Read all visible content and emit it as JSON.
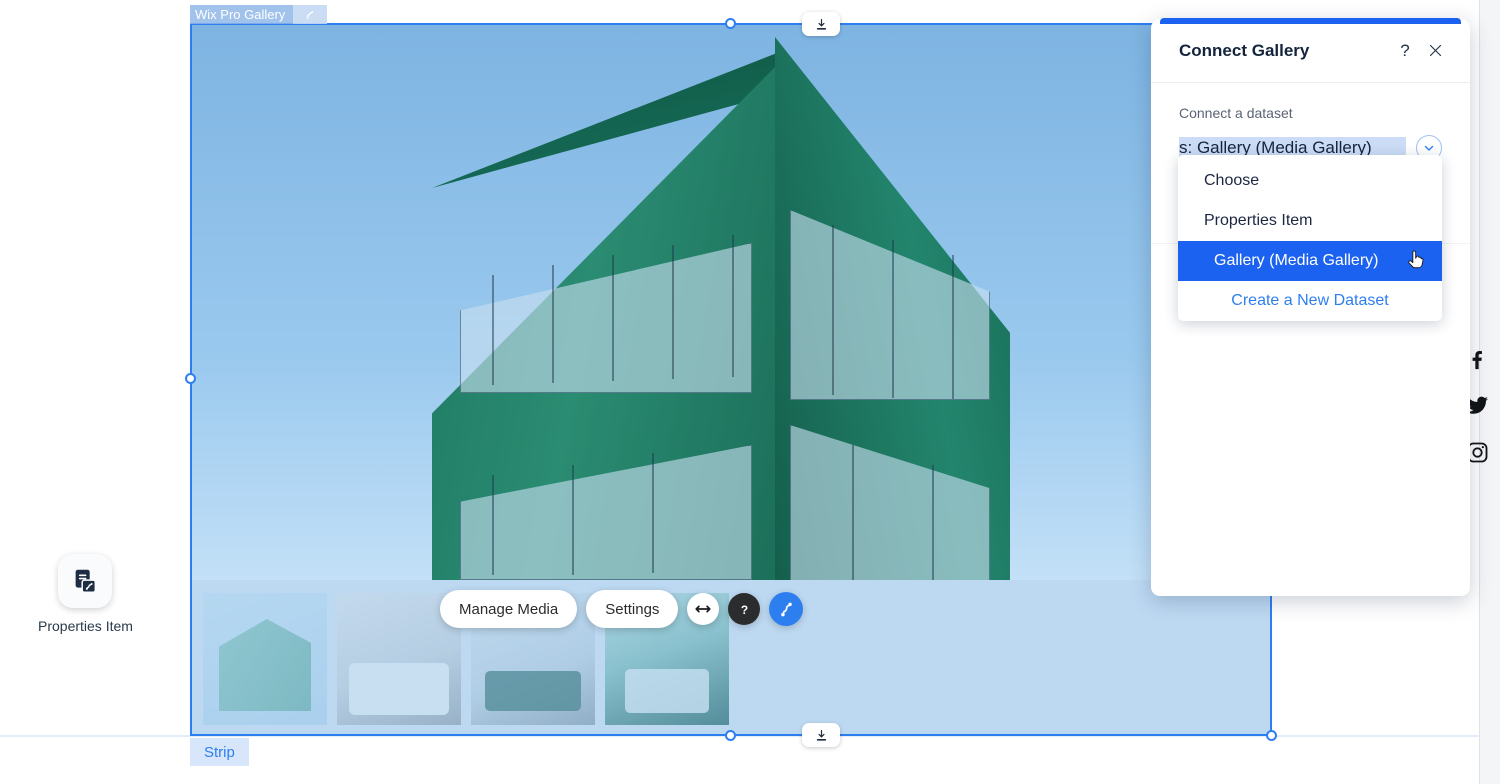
{
  "editor": {
    "widget_tag_label": "Wix Pro Gallery",
    "widget_tag_icon": "connect-icon",
    "strip_tag_label": "Strip",
    "collapse_top_icon": "download-icon",
    "collapse_bottom_icon": "download-icon",
    "accent_blue": "#2d7ff0",
    "selection_fill": "#bdd9f2"
  },
  "gallery_toolbar": {
    "manage_media_label": "Manage Media",
    "settings_label": "Settings",
    "stretch_icon": "arrows-horizontal-icon",
    "help_icon": "question-mark-icon",
    "connect_icon": "connect-data-icon"
  },
  "gallery_thumbnails": [
    {
      "name": "thumb-building-exterior"
    },
    {
      "name": "thumb-bedroom"
    },
    {
      "name": "thumb-living-room"
    },
    {
      "name": "thumb-dining-room"
    }
  ],
  "properties_widget": {
    "icon": "dataset-item-icon",
    "label": "Properties Item"
  },
  "social": [
    {
      "name": "facebook-icon"
    },
    {
      "name": "twitter-icon"
    },
    {
      "name": "instagram-icon"
    }
  ],
  "panel": {
    "title": "Connect Gallery",
    "help_icon": "question-mark-icon",
    "close_icon": "close-icon",
    "field_label": "Connect a dataset",
    "selected_value": "s: Gallery (Media Gallery)",
    "caret_icon": "chevron-down-icon",
    "dropdown": {
      "options": [
        {
          "label": "Choose",
          "selected": false,
          "is_action": false
        },
        {
          "label": "Properties Item",
          "selected": false,
          "is_action": false
        },
        {
          "label": "Gallery (Media Gallery)",
          "selected": true,
          "is_action": false
        },
        {
          "label": "Create a New Dataset",
          "selected": false,
          "is_action": true
        }
      ]
    }
  }
}
